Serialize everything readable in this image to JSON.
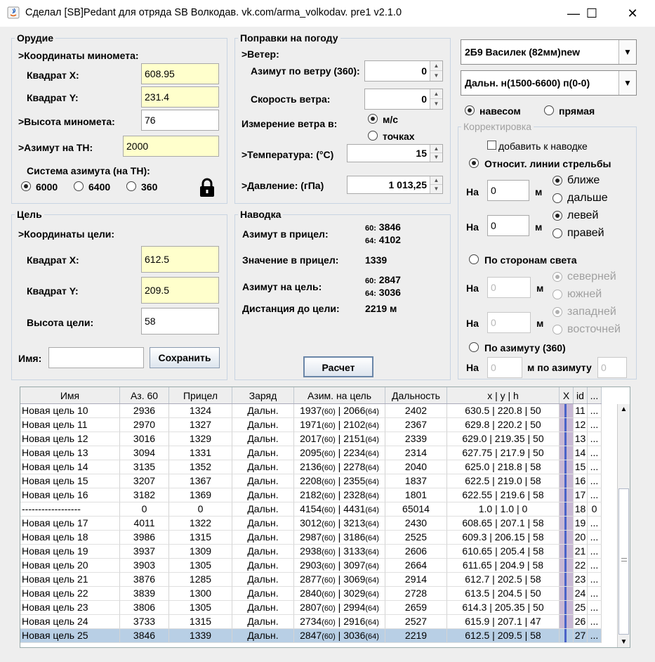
{
  "window": {
    "title": "Сделал [SB]Pedant для отряда SB Волкодав. vk.com/arma_volkodav. pre1 v2.1.0",
    "minimize": "—",
    "maximize": "☐",
    "close": "✕"
  },
  "weapon": {
    "title": "Орудие",
    "coords_label": ">Координаты миномета:",
    "sq_x_label": "Квадрат X:",
    "sq_x": "608.95",
    "sq_y_label": "Квадрат Y:",
    "sq_y": "231.4",
    "height_label": ">Высота миномета:",
    "height": "76",
    "azimuth_label": ">Азимут на ТН:",
    "azimuth": "2000",
    "system_label": "Система азимута (на ТН):",
    "opt_6000": "6000",
    "opt_6400": "6400",
    "opt_360": "360"
  },
  "weather": {
    "title": "Поправки на погоду",
    "wind_label": ">Ветер:",
    "wind_az_label": "Азимут по ветру (360):",
    "wind_az": "0",
    "wind_speed_label": "Скорость ветра:",
    "wind_speed": "0",
    "measure_label": "Измерение ветра в:",
    "opt_ms": "м/с",
    "opt_pts": "точках",
    "temp_label": ">Температура: (°C)",
    "temp": "15",
    "pressure_label": ">Давление: (гПа)",
    "pressure": "1 013,25"
  },
  "selectors": {
    "weapon_type": "2Б9 Василек (82мм)new",
    "range": "Дальн. н(1500-6600) п(0-0)",
    "opt_high": "навесом",
    "opt_direct": "прямая"
  },
  "correction": {
    "title": "Корректировка",
    "add_label": "добавить к наводке",
    "rel_label": "Относит. линии стрельбы",
    "on": "На",
    "m": "м",
    "val1": "0",
    "val2": "0",
    "closer": "ближе",
    "farther": "дальше",
    "left": "левей",
    "right": "правей",
    "cardinal_label": "По сторонам света",
    "cval1": "0",
    "cval2": "0",
    "north": "северней",
    "south": "южней",
    "west": "западней",
    "east": "восточней",
    "az_label": "По азимуту (360)",
    "az_val": "0",
    "by_az": "м по азимуту",
    "az_deg": "0"
  },
  "target": {
    "title": "Цель",
    "coords_label": ">Координаты цели:",
    "sq_x_label": "Квадрат X:",
    "sq_x": "612.5",
    "sq_y_label": "Квадрат Y:",
    "sq_y": "209.5",
    "height_label": "Высота цели:",
    "height": "58",
    "name_label": "Имя:",
    "name": "",
    "save": "Сохранить"
  },
  "aim": {
    "title": "Наводка",
    "az_sight_label": "Азимут в прицел:",
    "p60": "60:",
    "p64": "64:",
    "az_sight_60": "3846",
    "az_sight_64": "4102",
    "sight_label": "Значение в прицел:",
    "sight": "1339",
    "az_target_label": "Азимут на цель:",
    "az_target_60": "2847",
    "az_target_64": "3036",
    "dist_label": "Дистанция до цели:",
    "dist": "2219 м",
    "calc": "Расчет"
  },
  "table": {
    "headers": [
      "Имя",
      "Аз. 60",
      "Прицел",
      "Заряд",
      "Азим. на цель",
      "Дальность",
      "x | y | h",
      "X",
      "id",
      "..."
    ],
    "rows": [
      [
        "Новая цель 10",
        "2936",
        "1324",
        "Дальн.",
        "1937",
        "2066",
        "2402",
        "630.5 | 220.8 | 50",
        "11",
        "..."
      ],
      [
        "Новая цель 11",
        "2970",
        "1327",
        "Дальн.",
        "1971",
        "2102",
        "2367",
        "629.8 | 220.2 | 50",
        "12",
        "..."
      ],
      [
        "Новая цель 12",
        "3016",
        "1329",
        "Дальн.",
        "2017",
        "2151",
        "2339",
        "629.0 | 219.35 | 50",
        "13",
        "..."
      ],
      [
        "Новая цель 13",
        "3094",
        "1331",
        "Дальн.",
        "2095",
        "2234",
        "2314",
        "627.75 | 217.9 | 50",
        "14",
        "..."
      ],
      [
        "Новая цель 14",
        "3135",
        "1352",
        "Дальн.",
        "2136",
        "2278",
        "2040",
        "625.0 | 218.8 | 58",
        "15",
        "..."
      ],
      [
        "Новая цель 15",
        "3207",
        "1367",
        "Дальн.",
        "2208",
        "2355",
        "1837",
        "622.5 | 219.0 | 58",
        "16",
        "..."
      ],
      [
        "Новая цель 16",
        "3182",
        "1369",
        "Дальн.",
        "2182",
        "2328",
        "1801",
        "622.55 | 219.6 | 58",
        "17",
        "..."
      ],
      [
        "------------------",
        "0",
        "0",
        "Дальн.",
        "4154",
        "4431",
        "65014",
        "1.0 | 1.0 | 0",
        "18",
        "0"
      ],
      [
        "Новая цель 17",
        "4011",
        "1322",
        "Дальн.",
        "3012",
        "3213",
        "2430",
        "608.65 | 207.1 | 58",
        "19",
        "..."
      ],
      [
        "Новая цель 18",
        "3986",
        "1315",
        "Дальн.",
        "2987",
        "3186",
        "2525",
        "609.3 | 206.15 | 58",
        "20",
        "..."
      ],
      [
        "Новая цель 19",
        "3937",
        "1309",
        "Дальн.",
        "2938",
        "3133",
        "2606",
        "610.65 | 205.4 | 58",
        "21",
        "..."
      ],
      [
        "Новая цель 20",
        "3903",
        "1305",
        "Дальн.",
        "2903",
        "3097",
        "2664",
        "611.65 | 204.9 | 58",
        "22",
        "..."
      ],
      [
        "Новая цель 21",
        "3876",
        "1285",
        "Дальн.",
        "2877",
        "3069",
        "2914",
        "612.7 | 202.5 | 58",
        "23",
        "..."
      ],
      [
        "Новая цель 22",
        "3839",
        "1300",
        "Дальн.",
        "2840",
        "3029",
        "2728",
        "613.5 | 204.5 | 50",
        "24",
        "..."
      ],
      [
        "Новая цель 23",
        "3806",
        "1305",
        "Дальн.",
        "2807",
        "2994",
        "2659",
        "614.3 | 205.35 | 50",
        "25",
        "..."
      ],
      [
        "Новая цель 24",
        "3733",
        "1315",
        "Дальн.",
        "2734",
        "2916",
        "2527",
        "615.9 | 207.1 | 47",
        "26",
        "..."
      ],
      [
        "Новая цель 25",
        "3846",
        "1339",
        "Дальн.",
        "2847",
        "3036",
        "2219",
        "612.5 | 209.5 | 58",
        "27",
        "..."
      ]
    ],
    "az_sep": " | ",
    "suf60": "(60)",
    "suf64": "(64)"
  }
}
